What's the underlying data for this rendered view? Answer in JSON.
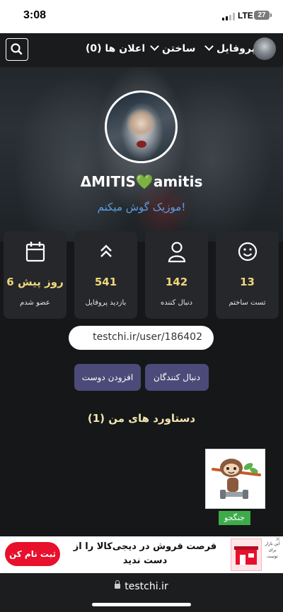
{
  "status_bar": {
    "time": "3:08",
    "network": "LTE",
    "battery": "27"
  },
  "nav": {
    "profile_label": "پروفایل",
    "create_label": "ساختن",
    "notifications_label": "اعلان ها (0)"
  },
  "profile": {
    "username": "ΔMITIS💚amitis",
    "bio": "موزیک گوش میکنم!",
    "url": "testchi.ir/user/186402"
  },
  "stats": [
    {
      "icon": "smiley-icon",
      "value": "13",
      "label": "تست ساختم"
    },
    {
      "icon": "user-icon",
      "value": "142",
      "label": "دنبال کننده"
    },
    {
      "icon": "chevrons-up-icon",
      "value": "541",
      "label": "بازدید پروفایل"
    },
    {
      "icon": "calendar-icon",
      "value": "6 روز پیش",
      "label": "عضو شدم"
    }
  ],
  "actions": {
    "followers_label": "دنبال کنندگان",
    "add_friend_label": "افزودن دوست"
  },
  "achievements": {
    "title": "دستاورد های من (1)",
    "badge_label": "جنگجو"
  },
  "ad": {
    "cta": "ثبت نام کن",
    "line1": "فرصت فروش در دیجی‌کالا را از",
    "line2": "دست ندید",
    "image_text": "این بازار برای توست"
  },
  "browser": {
    "address": "testchi.ir"
  },
  "colors": {
    "accent_button": "#4c4a78",
    "stat_value": "#f0d77a",
    "bio": "#5aa0e6",
    "badge": "#3eab4a",
    "ad_cta": "#e8102c"
  }
}
